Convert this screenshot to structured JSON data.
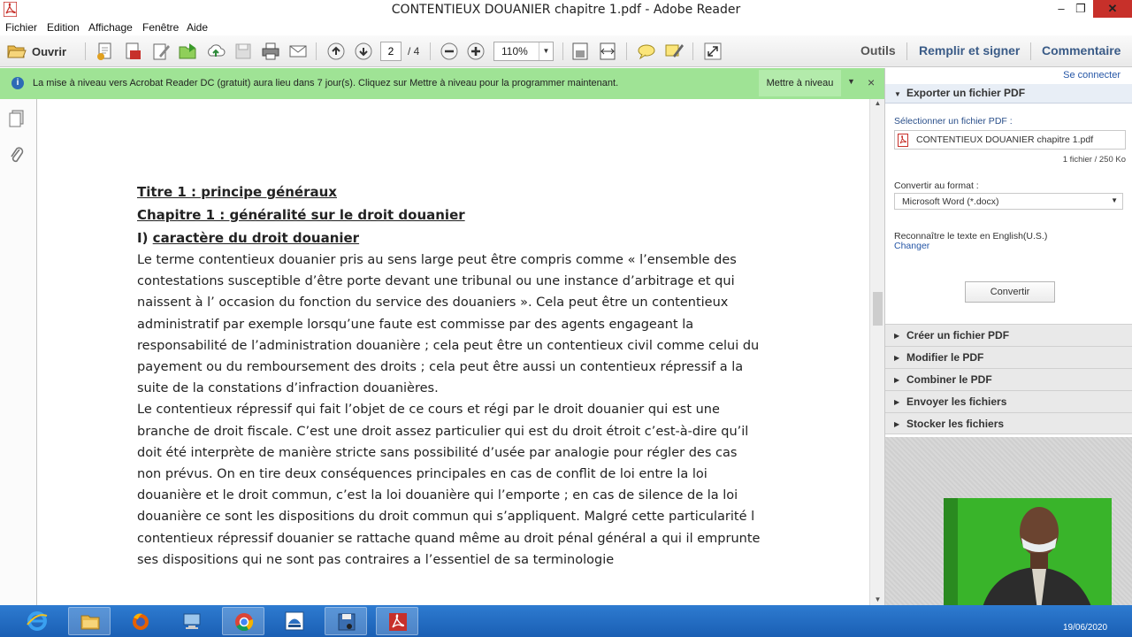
{
  "window": {
    "title": "CONTENTIEUX DOUANIER chapitre 1.pdf - Adobe Reader",
    "minimize": "–",
    "maximize": "❐",
    "close": "✕"
  },
  "menu": [
    "Fichier",
    "Edition",
    "Affichage",
    "Fenêtre",
    "Aide"
  ],
  "toolbar": {
    "open_label": "Ouvrir",
    "page_current": "2",
    "page_total": "/ 4",
    "zoom": "110%",
    "tools_label": "Outils",
    "fill_sign_label": "Remplir et signer",
    "comment_label": "Commentaire"
  },
  "notification": {
    "message": "La mise à niveau vers Acrobat Reader DC (gratuit) aura lieu dans 7 jour(s). Cliquez sur Mettre à niveau pour la programmer maintenant.",
    "upgrade_button": "Mettre à niveau",
    "close": "×"
  },
  "document": {
    "heading1": "Titre 1 : principe généraux",
    "heading2": "Chapitre  1 : généralité sur le droit douanier",
    "heading3_prefix": "I) ",
    "heading3": "caractère du droit douanier",
    "paragraph1": " Le terme contentieux douanier pris au sens large peut être compris comme «  l’ensemble des contestations susceptible d’être porte devant une tribunal ou une instance d’arbitrage et qui naissent à l’ occasion du fonction du service des douaniers ». Cela peut être un contentieux administratif par exemple lorsqu’une faute est commisse par des agents engageant la responsabilité de l’administration douanière ; cela peut être un contentieux civil comme celui du payement ou du remboursement des droits ; cela peut être aussi un contentieux répressif a la suite de la constations d’infraction douanières.",
    "paragraph2": "Le contentieux répressif qui fait l’objet de ce cours et régi par le droit douanier qui est une branche de droit fiscale. C’est une droit assez particulier qui est du droit étroit c’est-à-dire qu’il doit été interprète de manière stricte sans possibilité d’usée par analogie pour régler des cas non prévus. On en tire deux conséquences principales  en cas de conflit de loi entre la loi douanière et le droit commun, c’est la loi douanière qui l’emporte ; en cas de silence de la loi douanière ce sont les dispositions du droit commun qui s’appliquent. Malgré cette particularité l contentieux répressif douanier se rattache quand même au droit pénal général a qui il emprunte ses dispositions qui ne sont pas contraires a l’essentiel de sa terminologie"
  },
  "right_panel": {
    "login": "Se connecter",
    "export_title": "Exporter un fichier PDF",
    "select_label": "Sélectionner un fichier PDF :",
    "file_name": "CONTENTIEUX DOUANIER chapitre 1.pdf",
    "file_count": "1 fichier / 250 Ko",
    "convert_label": "Convertir au format :",
    "format": "Microsoft Word (*.docx)",
    "recognize": "Reconnaître le texte en English(U.S.)",
    "change": "Changer",
    "convert_button": "Convertir",
    "sections": [
      "Créer un fichier PDF",
      "Modifier le PDF",
      "Combiner le PDF",
      "Envoyer les fichiers",
      "Stocker les fichiers"
    ]
  },
  "taskbar": {
    "date": "19/06/2020"
  },
  "colors": {
    "title_close": "#c7302a",
    "notification_bg": "#9fe395",
    "taskbar": "#1f66bd",
    "link": "#2556a6",
    "webcam_green": "#3aba2a"
  }
}
